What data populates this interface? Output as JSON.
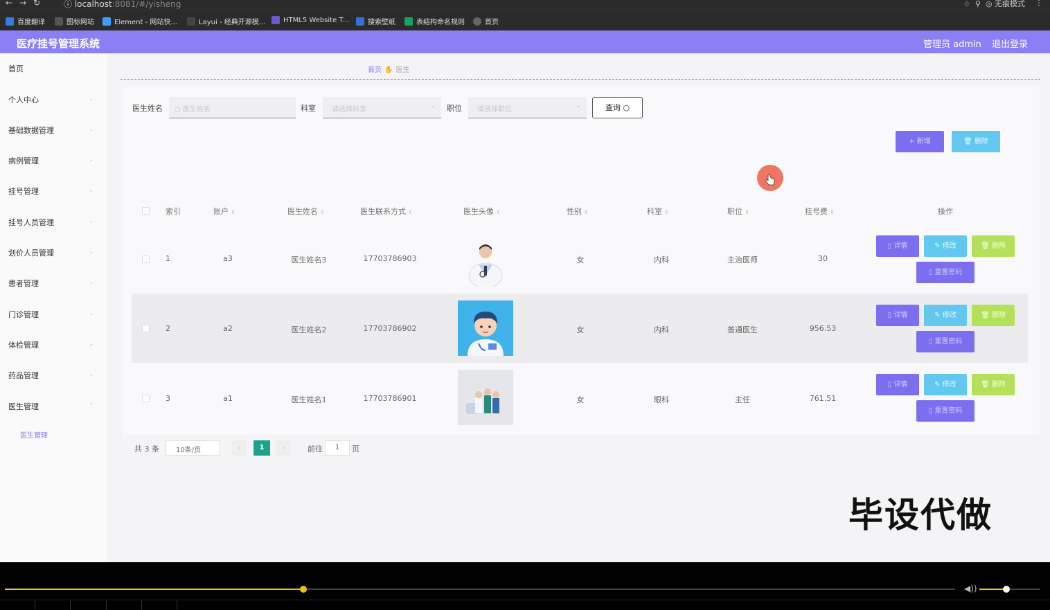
{
  "browser": {
    "url_host": "localhost",
    "url_rest": ":8081/#/yisheng",
    "incognito_label": "无痕模式",
    "bookmarks": [
      {
        "label": "百度翻译",
        "color": "#2f7de1"
      },
      {
        "label": "图标网站",
        "color": "#555555"
      },
      {
        "label": "Element - 网站快...",
        "color": "#409eff"
      },
      {
        "label": "Layui - 经典开源模...",
        "color": "#444444"
      },
      {
        "label": "HTML5 Website T...",
        "color": "#6a5acd"
      },
      {
        "label": "搜索壁纸",
        "color": "#3a6fd8"
      },
      {
        "label": "表结构命名规则",
        "color": "#1aa260"
      },
      {
        "label": "首页",
        "color": "#666666"
      }
    ]
  },
  "header": {
    "title": "医疗挂号管理系统",
    "admin": "管理员 admin",
    "logout": "退出登录",
    "accent": "#8a7ff5"
  },
  "sidebar": {
    "items": [
      "首页",
      "个人中心",
      "基础数据管理",
      "病例管理",
      "挂号管理",
      "挂号人员管理",
      "划价人员管理",
      "患者管理",
      "门诊管理",
      "体检管理",
      "药品管理",
      "医生管理"
    ],
    "sub_item": "医生管理"
  },
  "breadcrumb": {
    "home": "首页",
    "current": "医生"
  },
  "filters": {
    "name_label": "医生姓名",
    "name_placeholder": "医生姓名",
    "dept_label": "科室",
    "dept_placeholder": "请选择科室",
    "position_label": "职位",
    "position_placeholder": "请选择职位",
    "query_button": "查询"
  },
  "actions": {
    "add": "+ 新增",
    "delete": "删除"
  },
  "table": {
    "headers": [
      "索引",
      "账户",
      "医生姓名",
      "医生联系方式",
      "医生头像",
      "性别",
      "科室",
      "职位",
      "挂号费",
      "操作"
    ],
    "rows": [
      {
        "index": "1",
        "account": "a3",
        "name": "医生姓名3",
        "phone": "17703786903",
        "avatar": "doctor-photo",
        "gender": "女",
        "dept": "内科",
        "position": "主治医师",
        "fee": "30"
      },
      {
        "index": "2",
        "account": "a2",
        "name": "医生姓名2",
        "phone": "17703786902",
        "avatar": "cartoon-doctor",
        "gender": "女",
        "dept": "内科",
        "position": "普通医生",
        "fee": "956.53"
      },
      {
        "index": "3",
        "account": "a1",
        "name": "医生姓名1",
        "phone": "17703786901",
        "avatar": "medical-team",
        "gender": "女",
        "dept": "眼科",
        "position": "主任",
        "fee": "761.51"
      }
    ],
    "row_buttons": {
      "detail": "详情",
      "edit": "修改",
      "delete": "删除",
      "reset": "重置密码"
    }
  },
  "pagination": {
    "total": "共 3 条",
    "page_size": "10条/页",
    "current": "1",
    "goto_label": "前往",
    "goto_value": "1",
    "page_unit": "页"
  },
  "watermark": "毕设代做",
  "player": {
    "progress": 0.314,
    "volume": 0.44
  }
}
